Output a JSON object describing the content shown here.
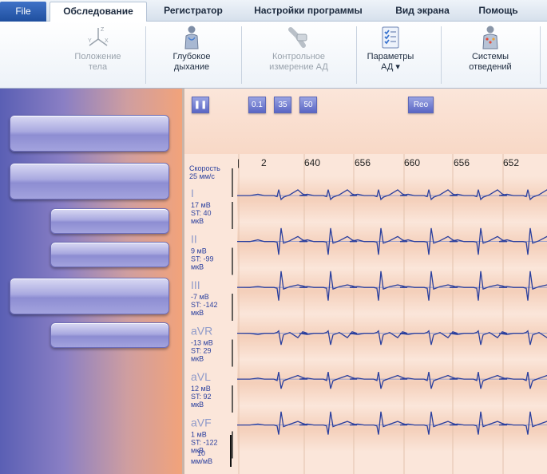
{
  "tabs": {
    "file": "File",
    "exam": "Обследование",
    "registrator": "Регистратор",
    "settings": "Настройки программы",
    "view": "Вид экрана",
    "help": "Помощь"
  },
  "ribbon": {
    "body_position": "Положение\nтела",
    "deep_breath": "Глубокое\nдыхание",
    "bp_check": "Контрольное\nизмерение АД",
    "bp_params": "Параметры\nАД ▾",
    "leads": "Системы\nотведений"
  },
  "controls": {
    "pause": "❚❚",
    "filter": "0.1",
    "f35": "35",
    "f50": "50",
    "reo": "Reo"
  },
  "rr_labels": [
    "|",
    "2",
    "640",
    "656",
    "660",
    "656",
    "652"
  ],
  "speed_label": "Скорость\n25 мм/с",
  "leads": [
    {
      "name": "I",
      "info": "17 мВ\nST: 40\nмкВ"
    },
    {
      "name": "II",
      "info": "9 мВ\nST: -99\nмкВ"
    },
    {
      "name": "III",
      "info": "-7 мВ\nST: -142\nмкВ"
    },
    {
      "name": "aVR",
      "info": "-13 мВ\nST: 29\nмкВ"
    },
    {
      "name": "aVL",
      "info": "12 мВ\nST: 92\nмкВ"
    },
    {
      "name": "aVF",
      "info": "1 мВ\nST: -122\nмкВ"
    }
  ],
  "scale_label": "10\nмм/мВ",
  "colors": {
    "trace": "#2a3f9e",
    "accent": "#5a66c4",
    "ecg_bg": "#fbe6da"
  }
}
